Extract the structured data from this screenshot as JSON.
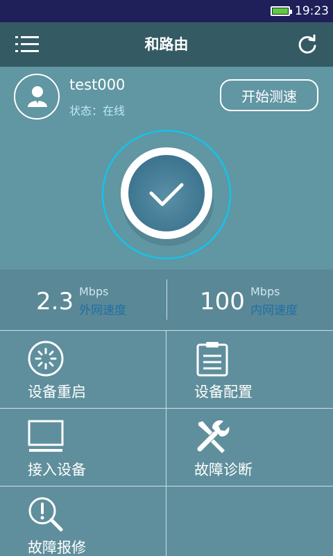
{
  "status_bar": {
    "time": "19:23",
    "battery_color": "#5ecb3a"
  },
  "header": {
    "title": "和路由",
    "menu_icon": "menu-list-icon",
    "refresh_icon": "refresh-icon"
  },
  "user": {
    "name": "test000",
    "status_label": "状态：",
    "status_value": "在线"
  },
  "actions": {
    "speedtest_label": "开始测速"
  },
  "speed": {
    "external": {
      "value": "2.3",
      "unit": "Mbps",
      "label": "外网速度"
    },
    "internal": {
      "value": "100",
      "unit": "Mbps",
      "label": "内网速度"
    }
  },
  "menu": [
    {
      "label": "设备重启",
      "icon": "restart-icon"
    },
    {
      "label": "设备配置",
      "icon": "clipboard-config-icon"
    },
    {
      "label": "接入设备",
      "icon": "monitor-icon"
    },
    {
      "label": "故障诊断",
      "icon": "tools-icon"
    },
    {
      "label": "故障报修",
      "icon": "search-alert-icon"
    }
  ],
  "colors": {
    "header": "#345a63",
    "accent_ring": "#16c3e8",
    "speed_label": "#1f6fa6"
  }
}
